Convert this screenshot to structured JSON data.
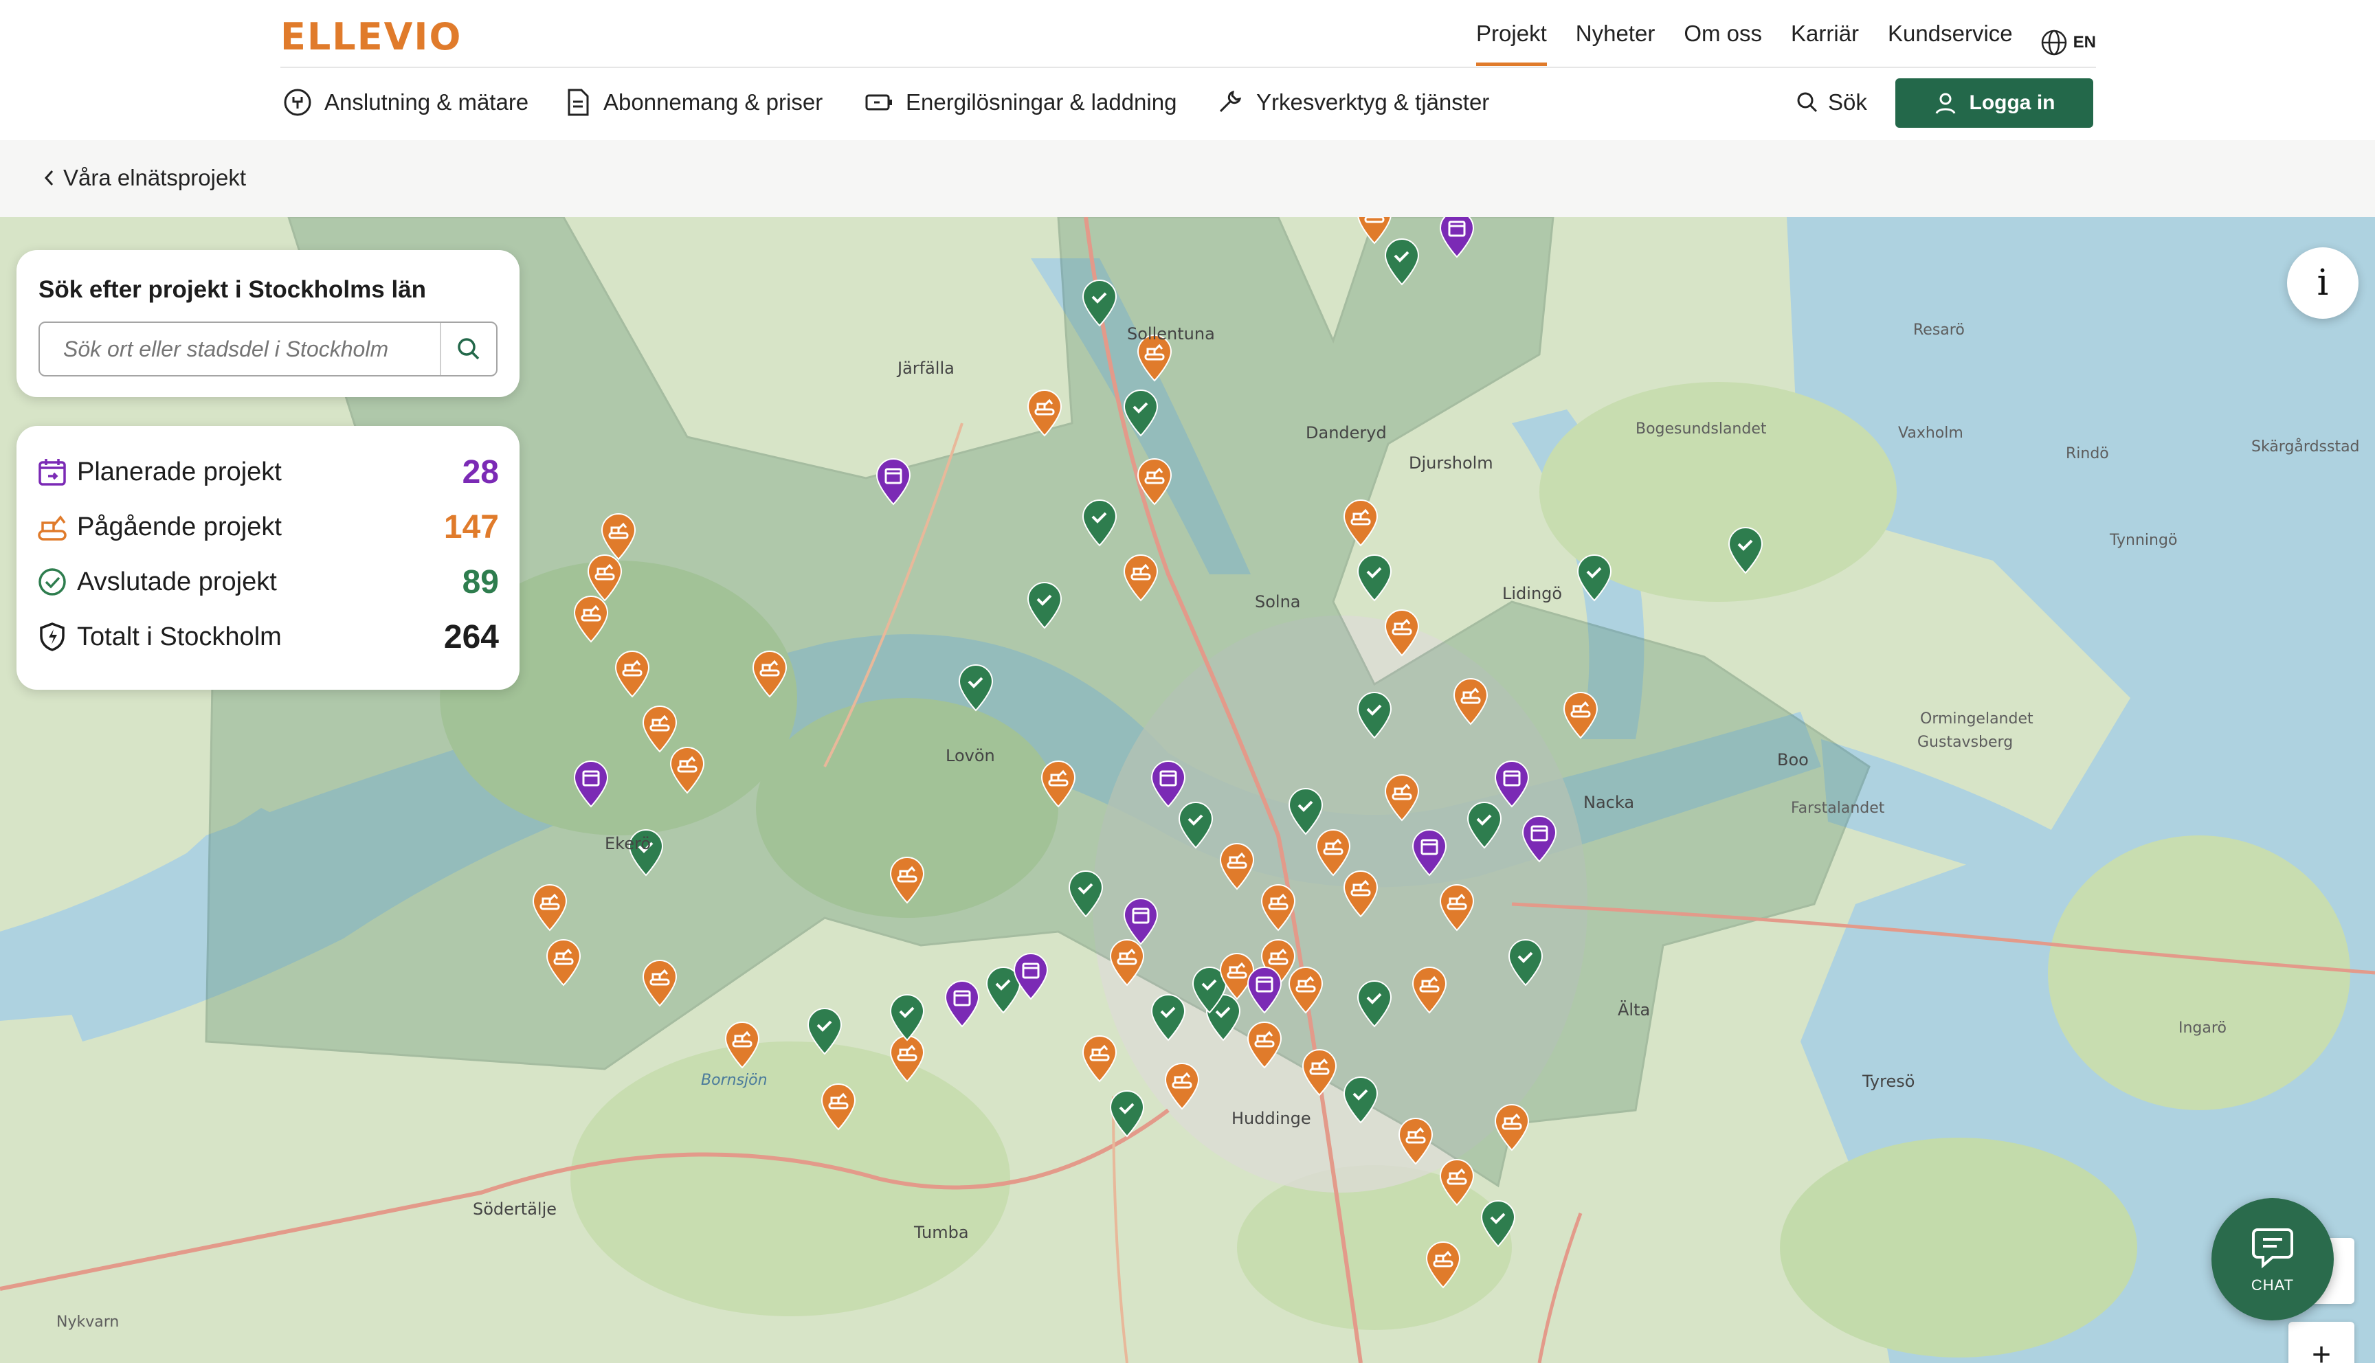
{
  "header": {
    "logo": "ELLEVIO",
    "top_links": [
      "Projekt",
      "Nyheter",
      "Om oss",
      "Karriär",
      "Kundservice"
    ],
    "active_top_link": "Projekt",
    "language": "EN",
    "main_nav": [
      {
        "label": "Anslutning & mätare",
        "icon": "plug-circle-icon"
      },
      {
        "label": "Abonnemang & priser",
        "icon": "document-icon"
      },
      {
        "label": "Energilösningar & laddning",
        "icon": "battery-icon"
      },
      {
        "label": "Yrkesverktyg & tjänster",
        "icon": "wrench-icon"
      }
    ],
    "search_label": "Sök",
    "login_label": "Logga in",
    "accent_color": "#e07b2b",
    "brand_green": "#23684a"
  },
  "breadcrumb": {
    "back_label": "Våra elnätsprojekt"
  },
  "search_panel": {
    "title": "Sök efter projekt i Stockholms län",
    "placeholder": "Sök ort eller stadsdel i Stockholm"
  },
  "stats": [
    {
      "label": "Planerade projekt",
      "value": "28",
      "color": "#7b2ab5",
      "icon": "calendar-icon"
    },
    {
      "label": "Pågående projekt",
      "value": "147",
      "color": "#e07b2b",
      "icon": "excavator-icon"
    },
    {
      "label": "Avslutade projekt",
      "value": "89",
      "color": "#2e7d4e",
      "icon": "check-circle-icon"
    },
    {
      "label": "Totalt i Stockholm",
      "value": "264",
      "color": "#1d1d1d",
      "icon": "bolt-shield-icon"
    }
  ],
  "map": {
    "info_label": "i",
    "zoom_in_label": "+",
    "chat_label": "CHAT",
    "place_labels": [
      "Sollentuna",
      "Järfälla",
      "Danderyd",
      "Djursholm",
      "Lidingö",
      "Solna",
      "Ekerö",
      "Lovön",
      "Nacka",
      "Boo",
      "Huddinge",
      "Tumba",
      "Södertälje",
      "Tyresö",
      "Älta",
      "Bogesundslandet",
      "Vaxholm",
      "Ormingelandet",
      "Gustavsberg",
      "Farstalandet",
      "Ingarö",
      "Bornsjön",
      "Nykvarn",
      "Resarö",
      "Rindö",
      "Tynningö",
      "Skärgårdsstad"
    ],
    "pin_colors": {
      "planned": "#7b2ab5",
      "ongoing": "#e07b2b",
      "done": "#2e7d4e"
    }
  }
}
